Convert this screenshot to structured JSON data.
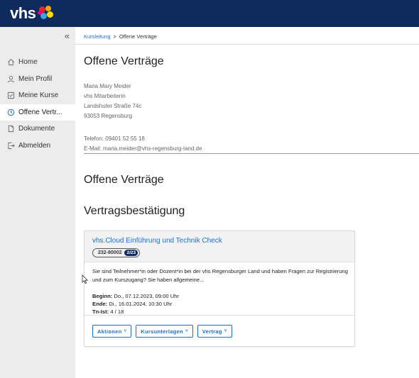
{
  "app": {
    "logo_text": "vhs",
    "colors": {
      "topbar": "#0f2a5c",
      "accent": "#1e6fd1",
      "sidebar": "#ececec"
    }
  },
  "sidebar": {
    "collapse_label": "«",
    "items": [
      {
        "label": "Home",
        "icon": "home-icon"
      },
      {
        "label": "Mein Profil",
        "icon": "user-icon"
      },
      {
        "label": "Meine Kurse",
        "icon": "checkbox-icon"
      },
      {
        "label": "Offene Vertr...",
        "icon": "clock-icon",
        "active": true
      },
      {
        "label": "Dokumente",
        "icon": "document-icon"
      },
      {
        "label": "Abmelden",
        "icon": "logout-icon"
      }
    ]
  },
  "breadcrumb": {
    "parent": "Kursleitung",
    "separator": ">",
    "current": "Offene Verträge"
  },
  "page": {
    "title": "Offene Verträge",
    "section_title": "Offene Verträge",
    "subsection_title": "Vertragsbestätigung"
  },
  "person": {
    "name": "Maria Mary Meider",
    "role": "vhs Mitarbeiterin",
    "street": "Landshuter Straße 74c",
    "city": "93053 Regensburg",
    "phone": "Telefon: 09401 52 55 18",
    "email": "E-Mail: maria.meider@vhs-regensburg-land.de"
  },
  "course": {
    "title": "vhs.Cloud Einführung und Technik Check",
    "number": "232-80002",
    "semester": "2/23",
    "description": "Sie sind Teilnehmer*in oder Dozent*in bei der vhs Regensburger Land und haben Fragen zur Registrierung und zum Kurszugang? Sie haben allgemeine...",
    "begin_label": "Beginn:",
    "begin_value": "Do., 07.12.2023, 09:00 Uhr",
    "end_label": "Ende:",
    "end_value": "Di., 16.01.2024, 10:30 Uhr",
    "tn_label": "Tn-Ist:",
    "tn_value": "4 / 18",
    "actions": [
      {
        "label": "Aktionen"
      },
      {
        "label": "Kursunterlagen"
      },
      {
        "label": "Vertrag"
      }
    ],
    "chevron": "˅"
  }
}
